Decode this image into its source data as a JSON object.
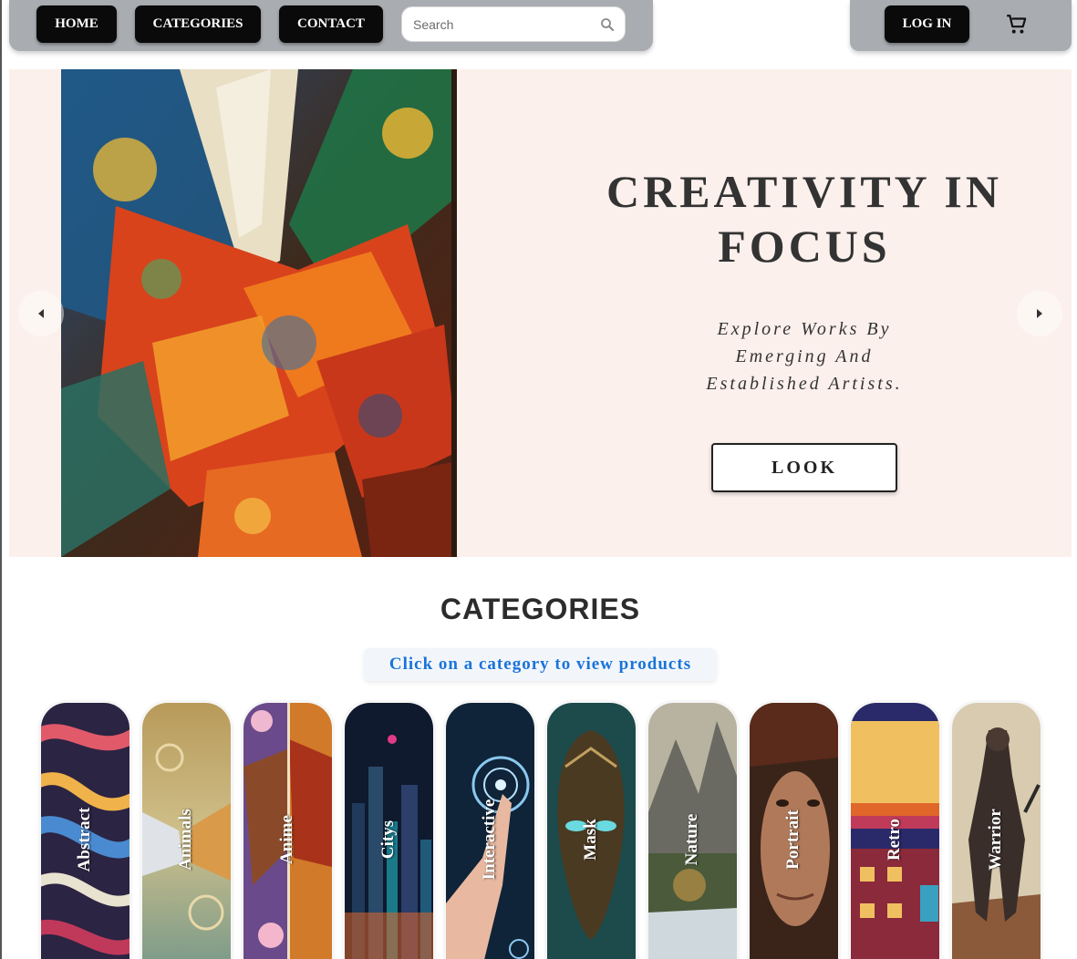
{
  "nav": {
    "home": "HOME",
    "categories": "CATEGORIES",
    "contact": "CONTACT",
    "search_placeholder": "Search",
    "login": "LOG IN"
  },
  "icons": {
    "search": "search-icon",
    "cart": "cart-icon",
    "prev": "chevron-left-icon",
    "next": "chevron-right-icon"
  },
  "hero": {
    "title": "CREATIVITY IN FOCUS",
    "subtitle": "Explore Works By Emerging And Established Artists.",
    "button": "LOOK"
  },
  "categories": {
    "heading": "CATEGORIES",
    "hint": "Click on a category to view products",
    "items": [
      {
        "label": "Abstract"
      },
      {
        "label": "Animals"
      },
      {
        "label": "Anime"
      },
      {
        "label": "Citys"
      },
      {
        "label": "Interactive"
      },
      {
        "label": "Mask"
      },
      {
        "label": "Nature"
      },
      {
        "label": "Portrait"
      },
      {
        "label": "Retro"
      },
      {
        "label": "Warrior"
      }
    ]
  },
  "colors": {
    "nav_bg": "#a9acb1",
    "button_bg": "#0a0a0a",
    "hero_bg": "#fcf0ec",
    "hint_text": "#1a73d9"
  }
}
